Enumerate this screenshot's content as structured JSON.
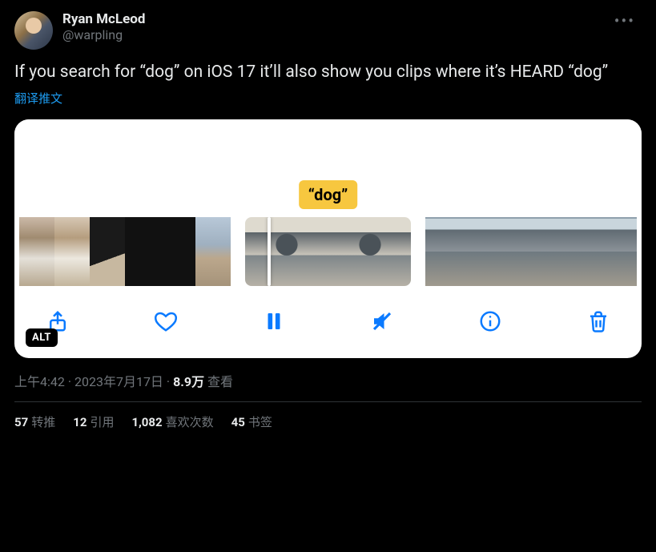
{
  "author": {
    "name": "Ryan McLeod",
    "handle": "@warpling"
  },
  "tweet_text": "If you search for “dog” on iOS 17 it’ll also show you clips where it’s HEARD “dog”",
  "translate_label": "翻译推文",
  "media": {
    "search_tag": "“dog”",
    "alt_badge": "ALT"
  },
  "meta": {
    "time": "上午4:42",
    "sep": " · ",
    "date": "2023年7月17日",
    "views_count": "8.9万",
    "views_label": " 查看"
  },
  "stats": {
    "retweets": {
      "count": "57",
      "label": "转推"
    },
    "quotes": {
      "count": "12",
      "label": "引用"
    },
    "likes": {
      "count": "1,082",
      "label": "喜欢次数"
    },
    "bookmarks": {
      "count": "45",
      "label": "书签"
    }
  }
}
